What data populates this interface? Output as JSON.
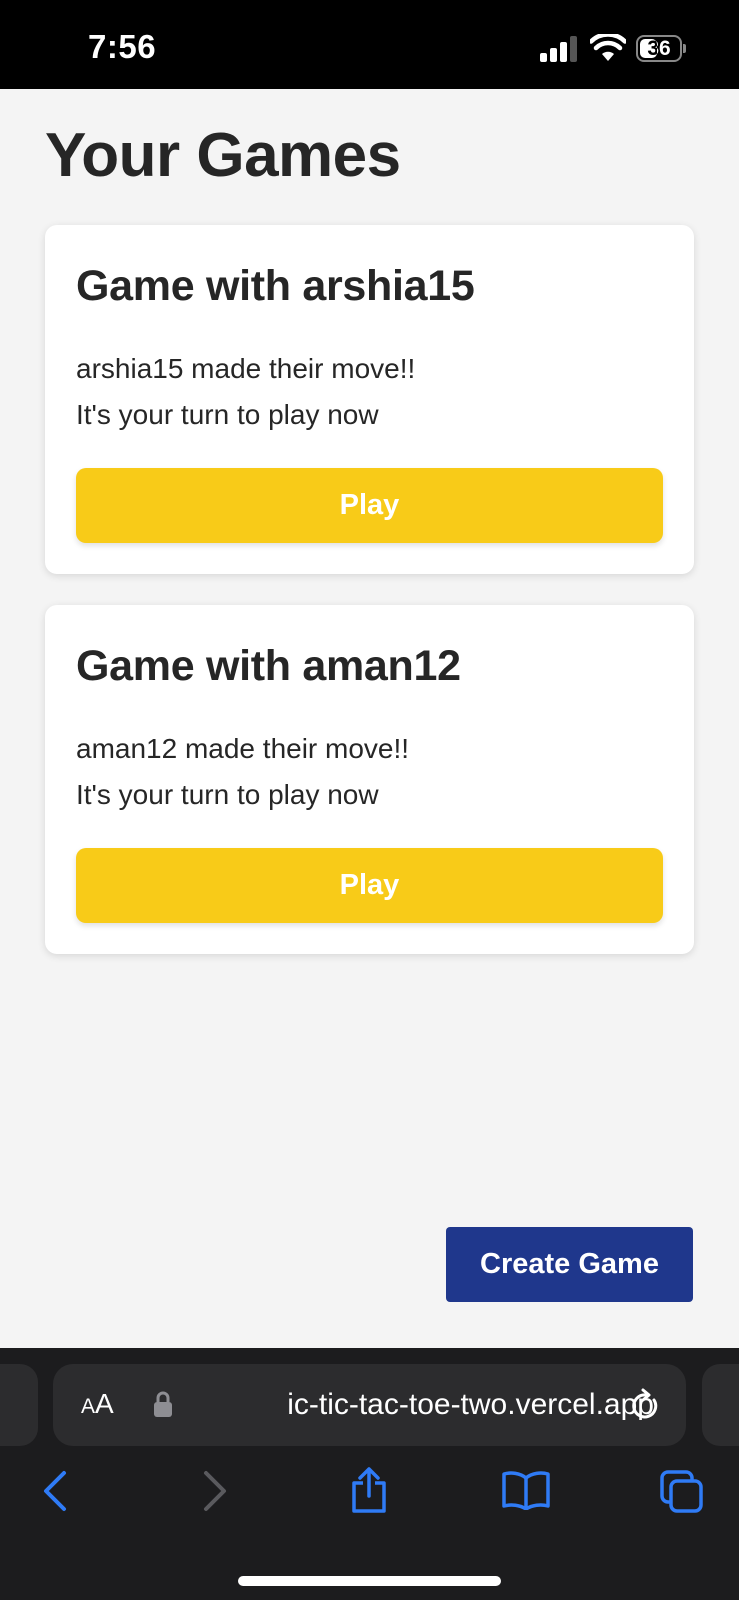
{
  "status_bar": {
    "time": "7:56",
    "battery_level": "36",
    "icons": [
      "signal-icon",
      "wifi-icon",
      "battery-icon"
    ]
  },
  "page": {
    "title": "Your Games"
  },
  "games": [
    {
      "title": "Game with arshia15",
      "message_line1": "arshia15 made their move!!",
      "message_line2": "It's your turn to play now",
      "button_label": "Play"
    },
    {
      "title": "Game with aman12",
      "message_line1": "aman12 made their move!!",
      "message_line2": "It's your turn to play now",
      "button_label": "Play"
    }
  ],
  "actions": {
    "create_game_label": "Create Game"
  },
  "browser": {
    "aa_label_small": "A",
    "aa_label_large": "A",
    "url": "ic-tic-tac-toe-two.vercel.app",
    "icons": [
      "back-icon",
      "forward-icon",
      "share-icon",
      "bookmarks-icon",
      "tabs-icon",
      "reload-icon",
      "lock-icon"
    ]
  },
  "colors": {
    "play_button": "#f8cb18",
    "create_button": "#1f378c",
    "ios_blue": "#2f7bf6"
  }
}
